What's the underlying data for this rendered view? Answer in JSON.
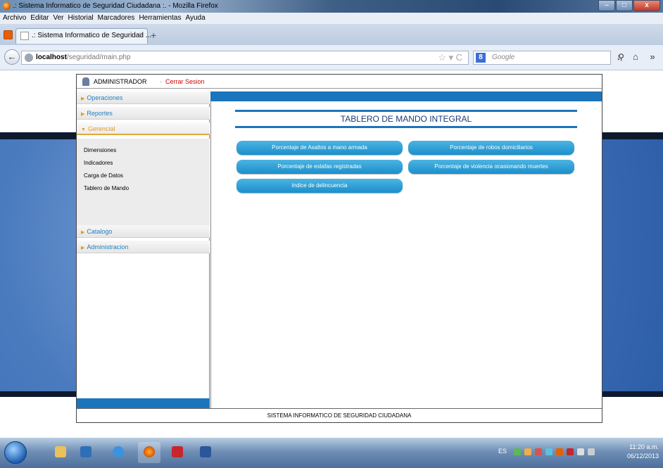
{
  "browser": {
    "window_title": ".: Sistema Informatico de Seguridad Ciudadana :. - Mozilla Firefox",
    "menu": [
      "Archivo",
      "Editar",
      "Ver",
      "Historial",
      "Marcadores",
      "Herramientas",
      "Ayuda"
    ],
    "tab_label": ".: Sistema Informatico de Seguridad ...",
    "tab_close": "×",
    "new_tab": "+",
    "url_host": "localhost",
    "url_path": "/seguridad/main.php",
    "search_placeholder": "Google",
    "search_engine_letter": "8"
  },
  "app": {
    "user": "ADMINISTRADOR",
    "separator": "-",
    "logout": "Cerrar Sesion",
    "sidebar": {
      "sections": [
        "Operaciones",
        "Reportes",
        "Gerencial",
        "Catalogo",
        "Administracion"
      ],
      "gerencial_items": [
        "Dimensiones",
        "Indicadores",
        "Carga de Datos",
        "Tablero de Mando"
      ]
    },
    "board_title": "TABLERO DE MANDO INTEGRAL",
    "buttons": [
      "Porcentaje de Asaltos a mano armada",
      "Porcentaje de robos domiciliarios",
      "Porcentaje de estafas registradas",
      "Porcentaje de violencia ocasionando muertes",
      "índice de delincuencia"
    ],
    "footer": "SISTEMA INFORMATICO DE SEGURIDAD CIUDADANA"
  },
  "taskbar": {
    "lang": "ES",
    "time": "11:20 a.m.",
    "date": "06/12/2013"
  },
  "colors": {
    "accent_blue": "#1b75bc",
    "button_blue": "#2a9ad6",
    "logout_red": "#d10000",
    "open_section_orange": "#e49b1e"
  }
}
